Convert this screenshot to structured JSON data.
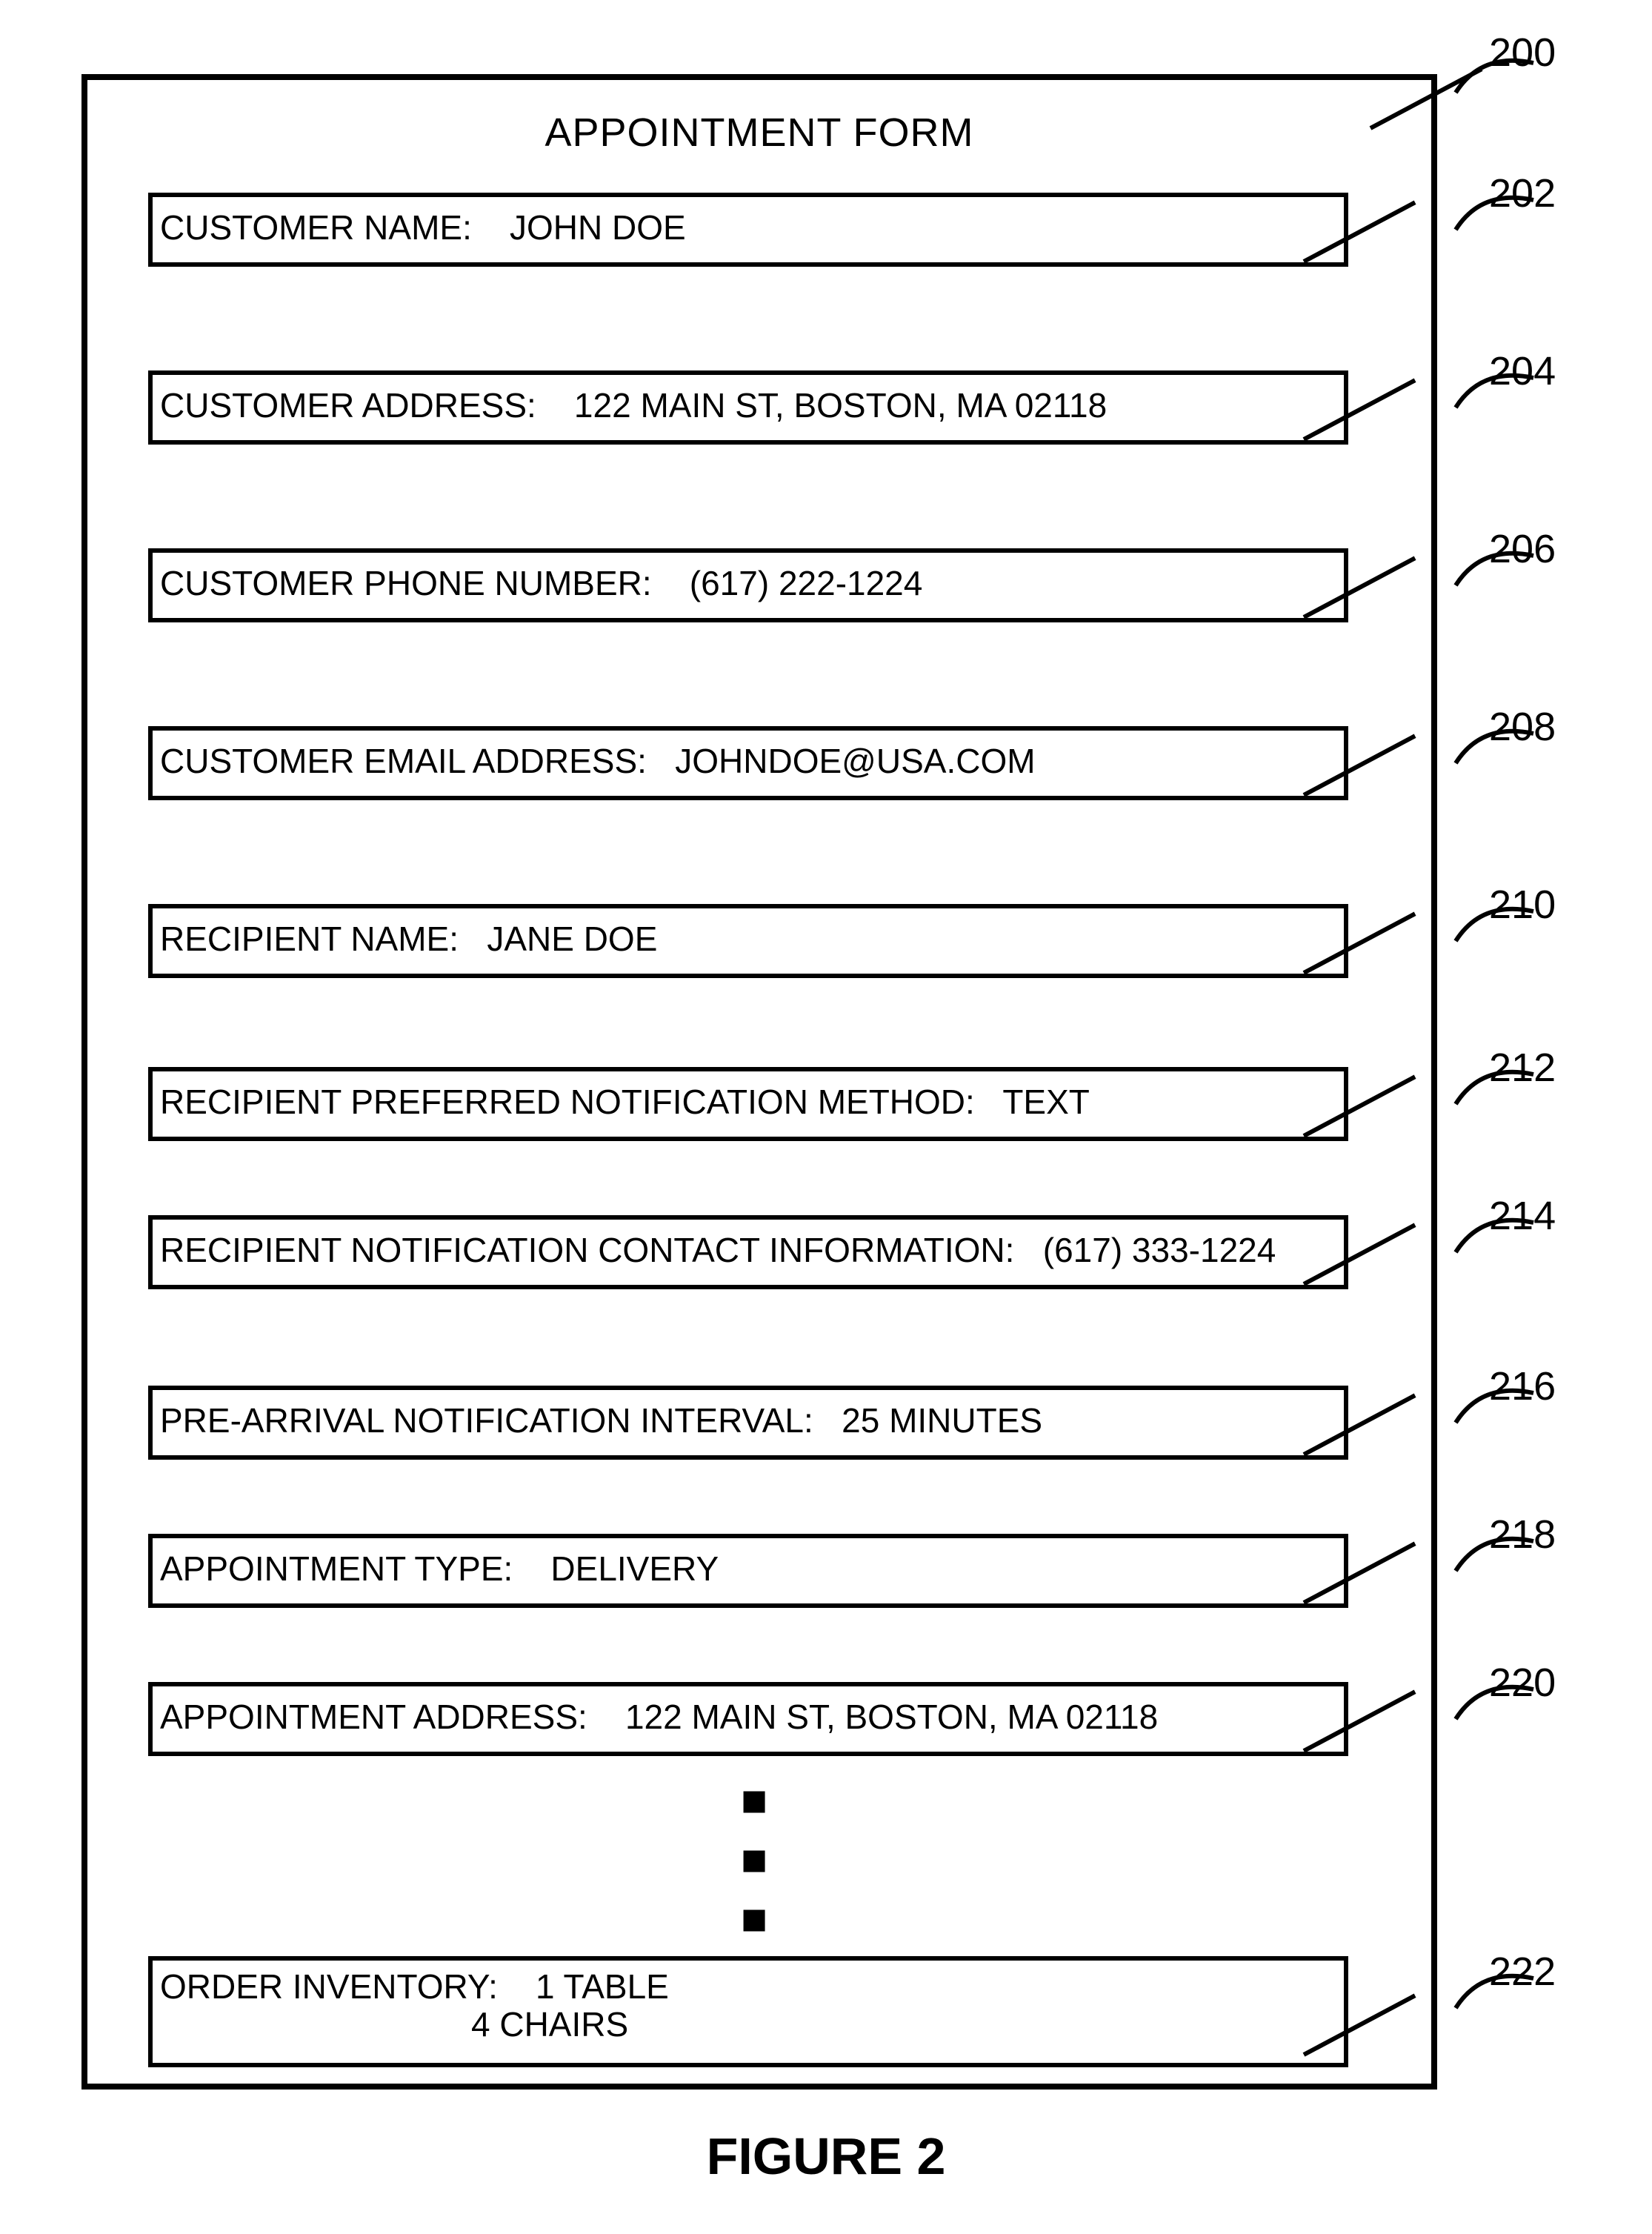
{
  "figure": {
    "caption": "FIGURE 2",
    "form_ref": "200"
  },
  "form": {
    "title": "APPOINTMENT FORM"
  },
  "fields": [
    {
      "ref": "202",
      "label": "CUSTOMER NAME:",
      "value": "JOHN DOE"
    },
    {
      "ref": "204",
      "label": "CUSTOMER ADDRESS:",
      "value": "122 MAIN ST, BOSTON, MA 02118"
    },
    {
      "ref": "206",
      "label": "CUSTOMER PHONE NUMBER:",
      "value": "(617) 222-1224"
    },
    {
      "ref": "208",
      "label": "CUSTOMER EMAIL ADDRESS:",
      "value": "JOHNDOE@USA.COM"
    },
    {
      "ref": "210",
      "label": "RECIPIENT NAME:",
      "value": "JANE DOE"
    },
    {
      "ref": "212",
      "label": "RECIPIENT PREFERRED NOTIFICATION METHOD:",
      "value": "TEXT"
    },
    {
      "ref": "214",
      "label": "RECIPIENT NOTIFICATION CONTACT INFORMATION:",
      "value": "(617) 333-1224"
    },
    {
      "ref": "216",
      "label": "PRE-ARRIVAL NOTIFICATION INTERVAL:",
      "value": "25 MINUTES"
    },
    {
      "ref": "218",
      "label": "APPOINTMENT TYPE:",
      "value": "DELIVERY"
    },
    {
      "ref": "220",
      "label": "APPOINTMENT ADDRESS:",
      "value": "122 MAIN ST, BOSTON, MA 02118"
    }
  ],
  "inventory": {
    "ref": "222",
    "label": "ORDER INVENTORY:",
    "line1": "1 TABLE",
    "line2": "4 CHAIRS"
  }
}
